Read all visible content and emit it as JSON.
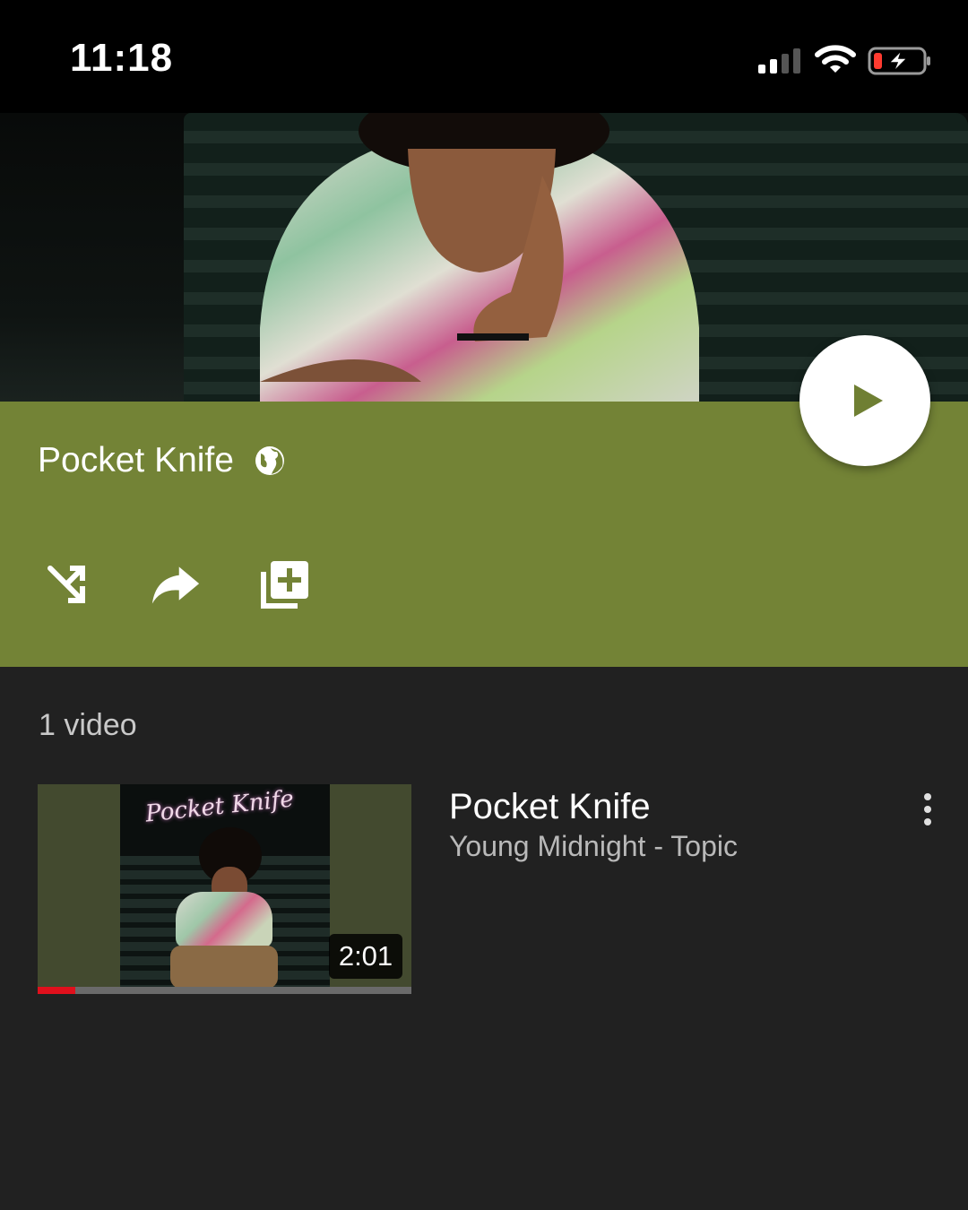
{
  "status_bar": {
    "time": "11:18",
    "icons": [
      "signal-icon",
      "wifi-icon",
      "battery-charging-icon"
    ]
  },
  "playlist": {
    "title": "Pocket Knife",
    "visibility_icon": "globe-icon",
    "actions": [
      "shuffle-icon",
      "share-icon",
      "add-to-playlist-icon"
    ],
    "play_icon": "play-icon",
    "banner_color": "#738336"
  },
  "list": {
    "video_count": "1 video",
    "items": [
      {
        "title": "Pocket Knife",
        "channel": "Young Midnight - Topic",
        "duration": "2:01",
        "thumbnail_text": "Pocket Knife",
        "watched_progress": 0.1,
        "progress_color": "#e0101c"
      }
    ]
  }
}
